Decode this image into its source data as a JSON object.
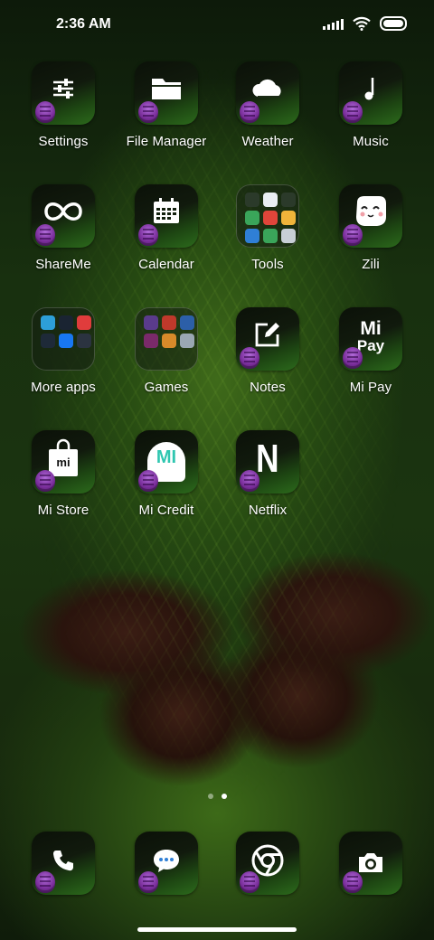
{
  "status_bar": {
    "time": "2:36 AM",
    "icons": [
      "signal-icon",
      "wifi-icon",
      "battery-icon"
    ]
  },
  "apps": [
    {
      "name": "settings",
      "label": "Settings",
      "icon": "sliders-icon"
    },
    {
      "name": "file-manager",
      "label": "File Manager",
      "icon": "folder-icon"
    },
    {
      "name": "weather",
      "label": "Weather",
      "icon": "cloud-icon"
    },
    {
      "name": "music",
      "label": "Music",
      "icon": "music-note-icon"
    },
    {
      "name": "shareme",
      "label": "ShareMe",
      "icon": "infinity-icon"
    },
    {
      "name": "calendar",
      "label": "Calendar",
      "icon": "calendar-icon"
    },
    {
      "name": "tools",
      "label": "Tools",
      "icon": "folder-grid-icon"
    },
    {
      "name": "zili",
      "label": "Zili",
      "icon": "smiley-face-icon"
    },
    {
      "name": "more-apps",
      "label": "More apps",
      "icon": "folder-grid-icon"
    },
    {
      "name": "games",
      "label": "Games",
      "icon": "folder-grid-icon"
    },
    {
      "name": "notes",
      "label": "Notes",
      "icon": "edit-pencil-icon"
    },
    {
      "name": "mi-pay",
      "label": "Mi Pay",
      "icon": "mi-pay-logo",
      "logo_top": "Mi",
      "logo_bottom": "Pay"
    },
    {
      "name": "mi-store",
      "label": "Mi Store",
      "icon": "shopping-bag-icon",
      "logo_text": "mi"
    },
    {
      "name": "mi-credit",
      "label": "Mi Credit",
      "icon": "mi-credit-logo",
      "logo_text": "MI"
    },
    {
      "name": "netflix",
      "label": "Netflix",
      "icon": "netflix-n-icon",
      "logo_text": "N"
    }
  ],
  "dock": [
    {
      "name": "phone",
      "icon": "phone-icon"
    },
    {
      "name": "messages",
      "icon": "message-bubble-icon"
    },
    {
      "name": "browser",
      "icon": "chrome-icon"
    },
    {
      "name": "camera",
      "icon": "camera-icon"
    }
  ],
  "page_indicator": {
    "pages": 2,
    "current": 2
  },
  "colors": {
    "tile_dark": "#0b1108",
    "tile_green": "#2c6a1c",
    "cone_purple": "#7a2e9b",
    "mi_credit_teal": "#2fc6b0"
  }
}
